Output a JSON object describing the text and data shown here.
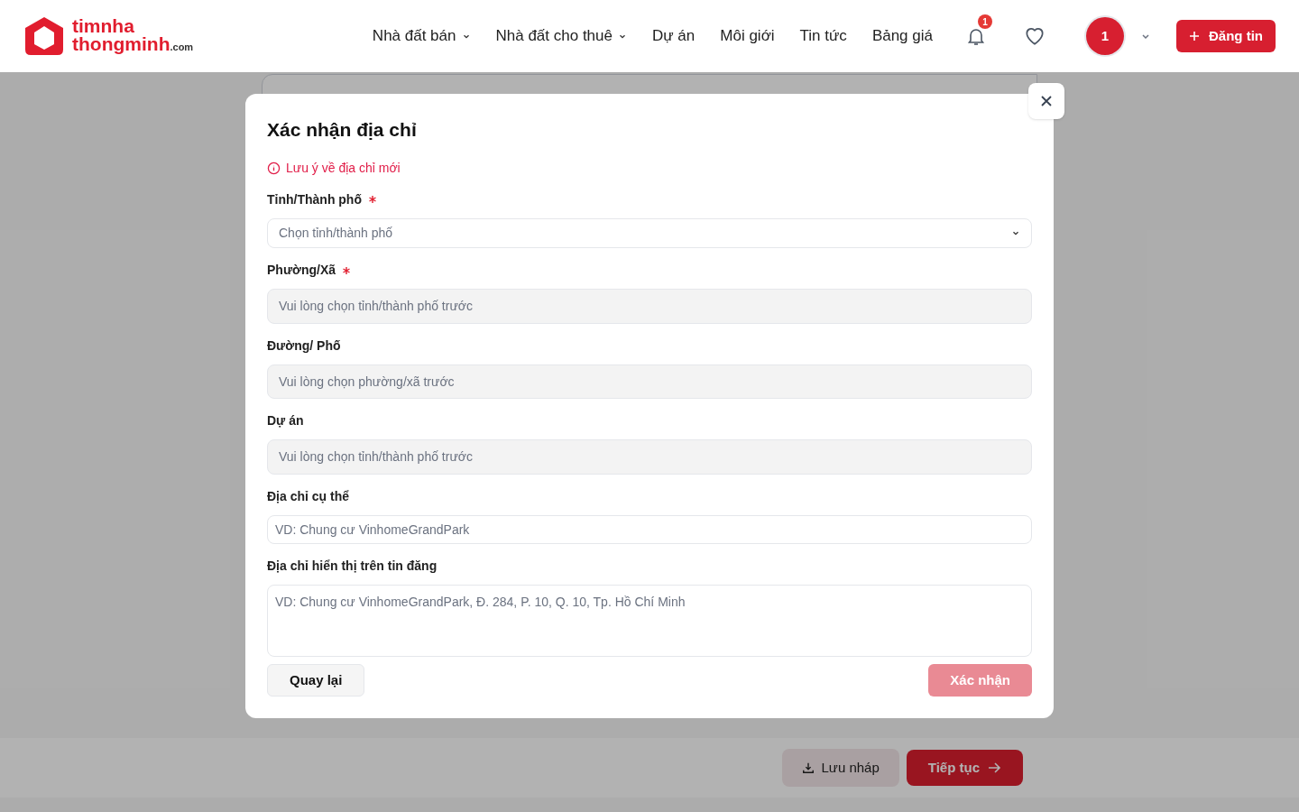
{
  "header": {
    "logo": {
      "line1": "timnha",
      "line2": "thongminh",
      "suffix": ".com"
    },
    "nav": [
      {
        "label": "Nhà đất bán",
        "dropdown": true
      },
      {
        "label": "Nhà đất cho thuê",
        "dropdown": true
      },
      {
        "label": "Dự án",
        "dropdown": false
      },
      {
        "label": "Môi giới",
        "dropdown": false
      },
      {
        "label": "Tin tức",
        "dropdown": false
      },
      {
        "label": "Bảng giá",
        "dropdown": false
      }
    ],
    "notification_count": "1",
    "avatar": "1",
    "post_button": "Đăng tin"
  },
  "modal": {
    "title": "Xác nhận địa chỉ",
    "notice": "Lưu ý về địa chỉ mới",
    "fields": [
      {
        "kind": "select",
        "label": "Tỉnh/Thành phố",
        "required": true,
        "placeholder": "Chọn tỉnh/thành phố",
        "disabled": false
      },
      {
        "kind": "input",
        "label": "Phường/Xã",
        "required": true,
        "placeholder": "Vui lòng chọn tỉnh/thành phố trước",
        "disabled": true
      },
      {
        "kind": "input",
        "label": "Đường/ Phố",
        "required": false,
        "placeholder": "Vui lòng chọn phường/xã trước",
        "disabled": true
      },
      {
        "kind": "input",
        "label": "Dự án",
        "required": false,
        "placeholder": "Vui lòng chọn tỉnh/thành phố trước",
        "disabled": true
      },
      {
        "kind": "text",
        "label": "Địa chỉ cụ thể",
        "required": false,
        "placeholder": "VD: Chung cư VinhomeGrandPark",
        "disabled": false
      },
      {
        "kind": "textarea",
        "label": "Địa chỉ hiển thị trên tin đăng",
        "required": false,
        "placeholder": "VD: Chung cư VinhomeGrandPark, Đ. 284, P. 10, Q. 10, Tp. Hồ Chí Minh",
        "disabled": false
      }
    ],
    "back_button": "Quay lại",
    "confirm_button": {
      "label": "Xác nhận",
      "disabled": true
    }
  },
  "footer": {
    "draft_button": "Lưu nháp",
    "next_button": "Tiếp tục"
  }
}
